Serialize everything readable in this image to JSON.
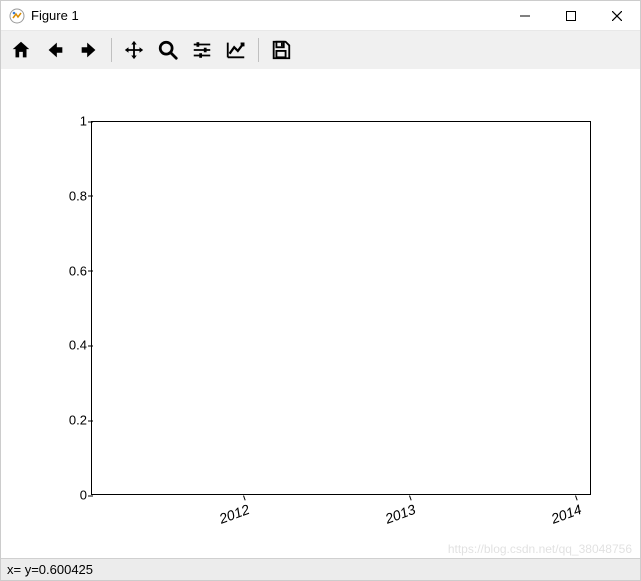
{
  "window": {
    "title": "Figure 1"
  },
  "toolbar": {
    "home": "Home",
    "back": "Back",
    "forward": "Forward",
    "pan": "Pan",
    "zoom": "Zoom",
    "subplots": "Configure subplots",
    "axes": "Edit axis",
    "save": "Save"
  },
  "status": {
    "coords": "x= y=0.600425"
  },
  "watermark": "https://blog.csdn.net/qq_38048756",
  "chart_data": {
    "type": "line",
    "title": "",
    "xlabel": "",
    "ylabel": "",
    "xticks": [
      "2012",
      "2013",
      "2014"
    ],
    "xtick_rotation_deg": 20,
    "yticks": [
      0.0,
      0.2,
      0.4,
      0.6,
      0.8,
      1.0
    ],
    "ylim": [
      0.0,
      1.0
    ],
    "series": []
  }
}
